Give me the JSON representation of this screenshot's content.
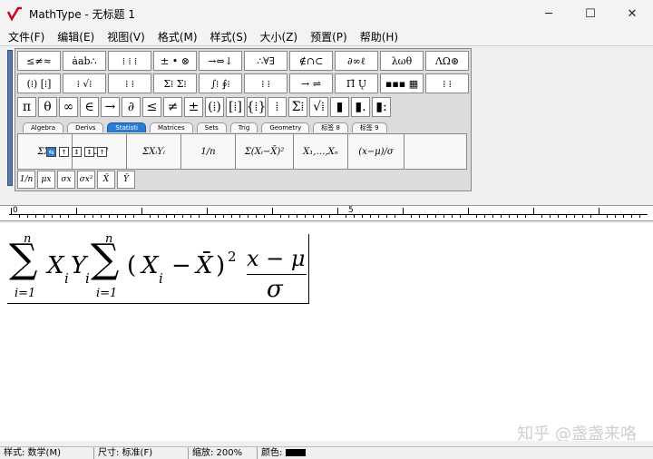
{
  "window": {
    "title": "MathType - 无标题 1",
    "minimize": "─",
    "maximize": "☐",
    "close": "✕"
  },
  "menu": [
    "文件(F)",
    "编辑(E)",
    "视图(V)",
    "格式(M)",
    "样式(S)",
    "大小(Z)",
    "预置(P)",
    "帮助(H)"
  ],
  "toolbar": {
    "row1": [
      "≤≠≈",
      "ȧab∴",
      "⁞ ⁞ ⁞",
      "± • ⊗",
      "→⇔↓",
      "∴∀∃",
      "∉∩⊂",
      "∂∞ℓ",
      "λωθ",
      "ΛΩ⊛"
    ],
    "row2": [
      "(⁞) [⁞]",
      "⁞ √⁞",
      "⁞ ⁞",
      "Σ⁞ Σ⁞",
      "∫⁞ ∮⁞",
      "⁞ ⁞",
      "→ ⇌",
      "Π̄ Ų",
      "▪▪▪ ▦",
      "⁞ ⁞"
    ],
    "row3": [
      "π",
      "θ",
      "∞",
      "∈",
      "→",
      "∂",
      "≤",
      "≠",
      "±",
      "(⁞)",
      "[⁞]",
      "{⁞}",
      "⁞",
      "Σ⁞",
      "√⁞",
      "▮",
      "▮.",
      "▮:"
    ],
    "tabs": [
      "Algebra",
      "Derivs",
      "Statisti",
      "Matrices",
      "Sets",
      "Trig",
      "Geometry",
      "标签 8",
      "标签 9"
    ],
    "active_tab": "Statisti",
    "templates": [
      "ΣXᵢ",
      "ΣXᵢ²",
      "ΣXᵢYᵢ",
      "1/n",
      "Σ(Xᵢ−X̄)²",
      "X₁,…,Xₙ",
      "(x−μ)/σ",
      ""
    ],
    "small": [
      "1/n",
      "μx",
      "σx",
      "σx²",
      "X̄",
      "Ȳ"
    ]
  },
  "nudge": [
    "⇆",
    "↑",
    "↕",
    "↕",
    "↑"
  ],
  "ruler": {
    "start": "0",
    "mid": "5"
  },
  "equation": {
    "sum": "∑",
    "upper": "n",
    "lower": "i=1",
    "X": "X",
    "Y": "Y",
    "i": "i",
    "lparen": "(",
    "minus": "−",
    "Xbar": "X̄",
    "rparen": ")",
    "sq": "2",
    "num": "x − μ",
    "den": "σ"
  },
  "watermark": "知乎 @盏盏来咯",
  "status": {
    "style": "样式: 数学(M)",
    "size": "尺寸: 标准(F)",
    "zoom": "缩放: 200%",
    "color": "颜色:"
  }
}
